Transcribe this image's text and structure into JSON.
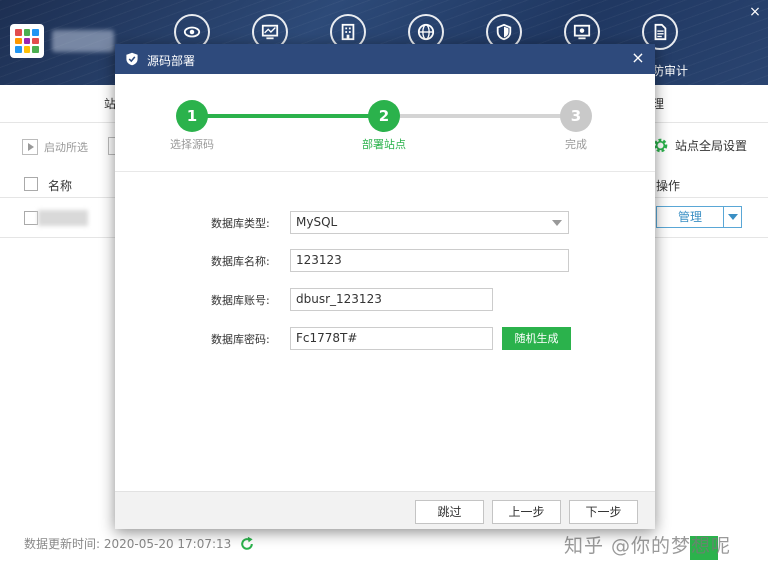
{
  "header": {
    "nav_label_right": "防审计",
    "nav_icons": [
      "eye-icon",
      "monitor-icon",
      "building-icon",
      "globe-icon",
      "shield-icon",
      "settings-screen-icon",
      "document-icon"
    ],
    "close": "×"
  },
  "tabs": {
    "left": "站",
    "right": "理"
  },
  "toolbar": {
    "start_selected": "启动所选",
    "site_settings": "站点全局设置"
  },
  "table": {
    "columns": {
      "name": "名称",
      "operation": "操作"
    },
    "row": {
      "manage": "管理"
    }
  },
  "footer": {
    "update_label": "数据更新时间: 2020-05-20 17:07:13",
    "watermark": "知乎 @你的梦想呢"
  },
  "modal": {
    "title": "源码部署",
    "close": "×",
    "steps": [
      {
        "number": "1",
        "label": "选择源码",
        "status": "done"
      },
      {
        "number": "2",
        "label": "部署站点",
        "status": "active"
      },
      {
        "number": "3",
        "label": "完成",
        "status": "todo"
      }
    ],
    "form": {
      "db_type_label": "数据库类型:",
      "db_type_value": "MySQL",
      "db_name_label": "数据库名称:",
      "db_name_value": "123123",
      "db_account_label": "数据库账号:",
      "db_account_value": "dbusr_123123",
      "db_password_label": "数据库密码:",
      "db_password_value": "Fc1778T#",
      "generate_label": "随机生成"
    },
    "buttons": {
      "skip": "跳过",
      "prev": "上一步",
      "next": "下一步"
    }
  },
  "colors": {
    "accent_green": "#2bb24c",
    "title_bar": "#2e4a7c",
    "link_blue": "#3a8fc4"
  }
}
